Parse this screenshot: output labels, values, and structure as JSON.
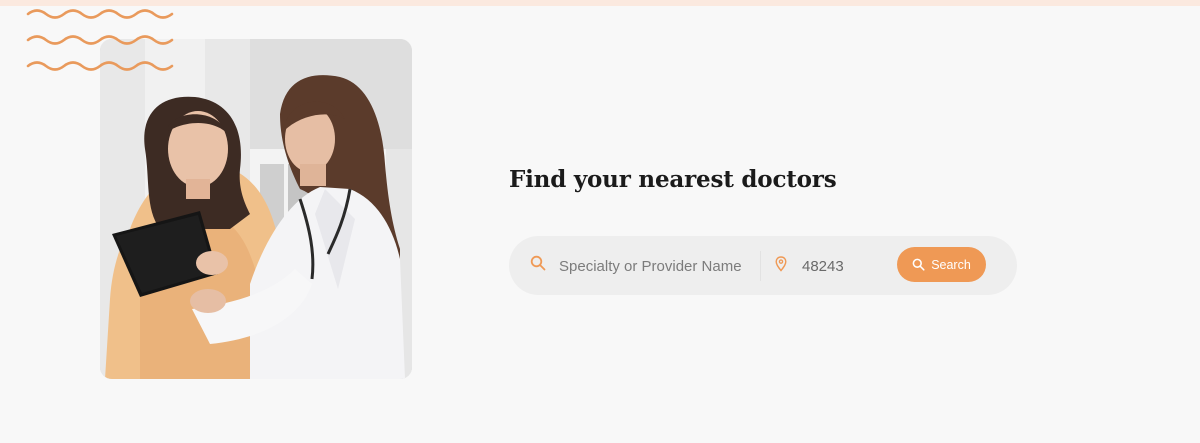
{
  "hero": {
    "heading": "Find your nearest doctors"
  },
  "search": {
    "specialty_placeholder": "Specialty or Provider Name",
    "location_value": "48243",
    "button_label": "Search",
    "icons": {
      "specialty": "search-icon",
      "location": "map-pin-icon",
      "button": "search-icon"
    }
  },
  "colors": {
    "accent": "#ef9955",
    "wave": "#e99a5c",
    "page_background": "#f8f8f8",
    "search_bar_background": "#eeeeee",
    "heading": "#1b1b1b"
  }
}
